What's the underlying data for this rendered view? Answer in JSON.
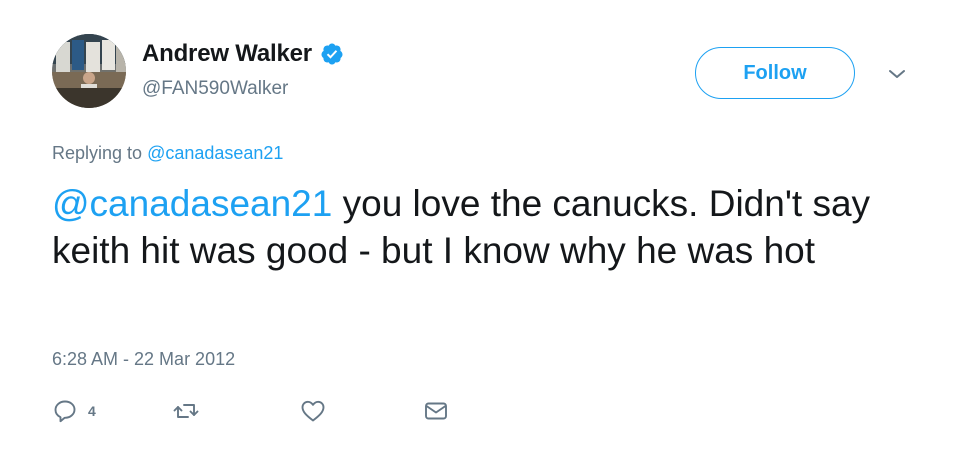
{
  "author": {
    "display_name": "Andrew Walker",
    "handle": "@FAN590Walker",
    "verified": true,
    "verified_icon": "verified-badge-icon"
  },
  "follow_button": {
    "label": "Follow"
  },
  "menu": {
    "icon": "chevron-down-icon"
  },
  "reply_context": {
    "prefix": "Replying to ",
    "mention": "@canadasean21"
  },
  "tweet": {
    "mention": "@canadasean21",
    "text": " you love the canucks. Didn't say keith hit was good - but I know why he was hot",
    "timestamp": "6:28 AM - 22 Mar 2012"
  },
  "actions": {
    "reply": {
      "icon": "reply-icon",
      "count": "4"
    },
    "retweet": {
      "icon": "retweet-icon"
    },
    "like": {
      "icon": "heart-icon"
    },
    "message": {
      "icon": "envelope-icon"
    }
  },
  "colors": {
    "accent": "#1da1f2",
    "text": "#14171a",
    "secondary": "#657786"
  }
}
